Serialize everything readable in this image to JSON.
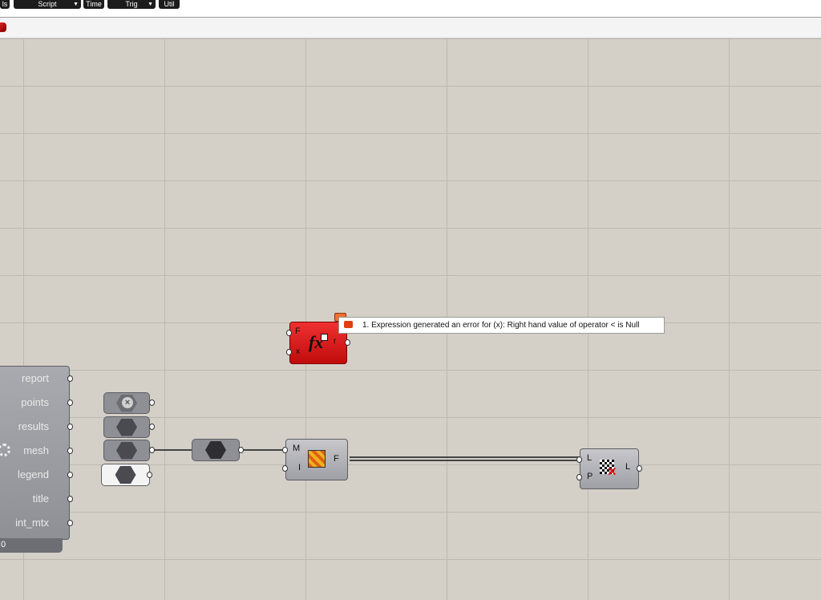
{
  "tabs": [
    {
      "label": "ls"
    },
    {
      "label": "Script"
    },
    {
      "label": "Time"
    },
    {
      "label": "Trig"
    },
    {
      "label": "Util"
    }
  ],
  "error_tooltip": "1. Expression generated an error for (x): Right hand value of operator < is Null",
  "expression_component": {
    "input_f": "F",
    "input_x": "x",
    "output_r": "r",
    "symbol": "fx"
  },
  "cluster_outputs": [
    "report",
    "points",
    "results",
    "mesh",
    "legend",
    "title",
    "int_mtx"
  ],
  "cluster_footer": "0",
  "deform_component": {
    "input_m": "M",
    "input_i": "I",
    "output_f": "F"
  },
  "cull_component": {
    "input_l": "L",
    "input_p": "P",
    "output_l": "L"
  },
  "colors": {
    "canvas": "#d4d0c8",
    "error_red": "#e01515",
    "component_grey": "#a7a8ae",
    "cluster_grey": "#9d9ea4"
  }
}
